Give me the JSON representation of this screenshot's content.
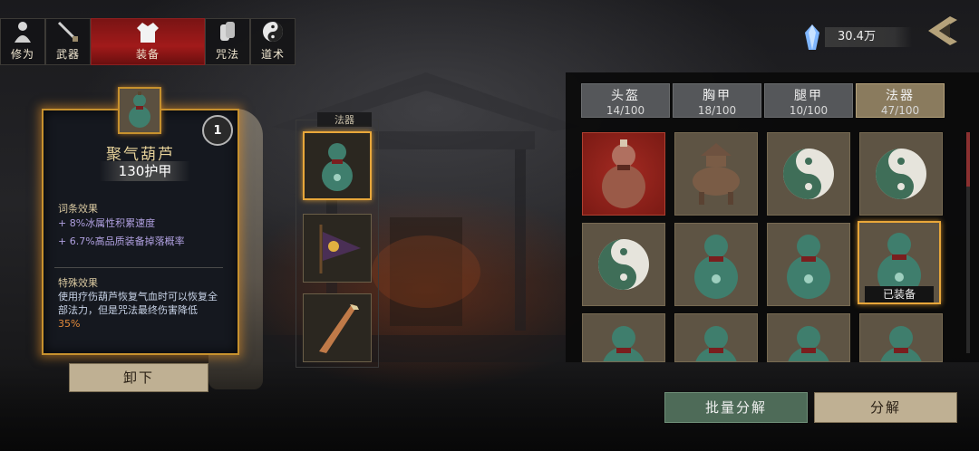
{
  "tabs": [
    {
      "label": "修为",
      "icon": "cultivation-icon",
      "active": false
    },
    {
      "label": "武器",
      "icon": "sword-icon",
      "active": false
    },
    {
      "label": "装备",
      "icon": "robe-icon",
      "active": true
    },
    {
      "label": "咒法",
      "icon": "scroll-icon",
      "active": false
    },
    {
      "label": "道术",
      "icon": "yin-yang-icon",
      "active": false
    }
  ],
  "currency": {
    "value": "30.4万",
    "icon": "crystal-icon"
  },
  "detail": {
    "name": "聚气葫芦",
    "armor_value": "130",
    "armor_label": "护甲",
    "badge": "1",
    "affix_title": "词条效果",
    "affixes": [
      {
        "prefix": "+ 8%",
        "text": "冰属性积累速度"
      },
      {
        "prefix": "+ 6.7%",
        "text": "高品质装备掉落概率"
      }
    ],
    "special_title": "特殊效果",
    "special_text": "使用疗伤葫芦恢复气血时可以恢复全部法力，但是咒法最终伤害降低",
    "special_highlight": "35%",
    "unequip_label": "卸下"
  },
  "equipped": {
    "title": "法器",
    "slots": [
      "gourd-icon",
      "banner-icon",
      "sword-scroll-icon"
    ]
  },
  "inventory": {
    "tabs": [
      {
        "name": "头盔",
        "count": "14/100",
        "active": false
      },
      {
        "name": "胸甲",
        "count": "18/100",
        "active": false
      },
      {
        "name": "腿甲",
        "count": "10/100",
        "active": false
      },
      {
        "name": "法器",
        "count": "47/100",
        "active": true
      }
    ],
    "equipped_tag": "已装备",
    "items": [
      "red-gourd",
      "bronze-censer",
      "yin-yang",
      "yin-yang",
      "yin-yang",
      "green-gourd",
      "green-gourd",
      "green-gourd",
      "green-gourd",
      "green-gourd",
      "green-gourd",
      "green-gourd"
    ]
  },
  "buttons": {
    "batch": "批量分解",
    "single": "分解"
  }
}
